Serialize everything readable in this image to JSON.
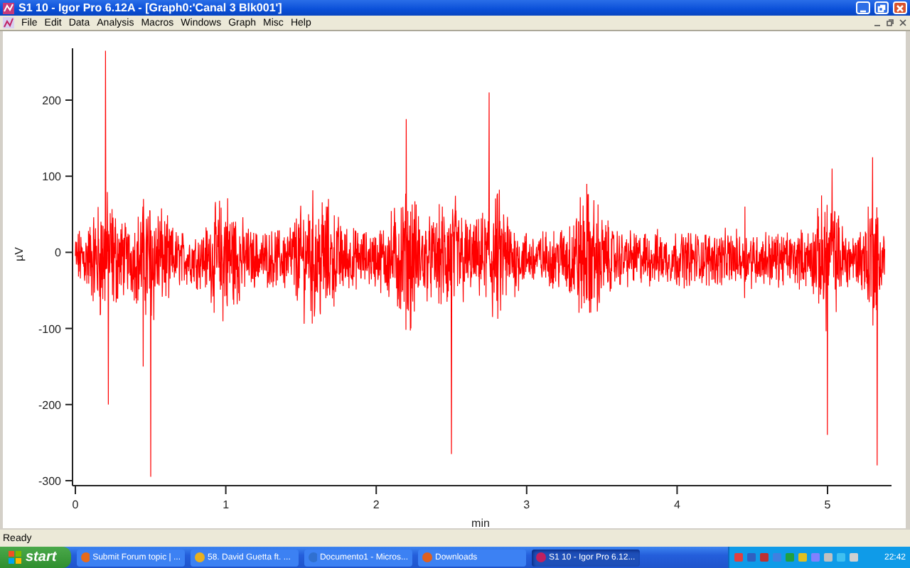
{
  "window": {
    "title": "S1 10 - Igor Pro 6.12A - [Graph0:'Canal 3 Blk001']"
  },
  "menu": [
    "File",
    "Edit",
    "Data",
    "Analysis",
    "Macros",
    "Windows",
    "Graph",
    "Misc",
    "Help"
  ],
  "graph": {
    "ylabel": "µV",
    "xlabel": "min",
    "yticks": [
      "200",
      "100",
      "0",
      "-100",
      "-200",
      "-300"
    ],
    "xticks": [
      "0",
      "1",
      "2",
      "3",
      "4",
      "5"
    ]
  },
  "status_bar": {
    "text": "Ready"
  },
  "taskbar": {
    "start": "start",
    "buttons": [
      {
        "label": "Submit Forum topic | ...",
        "selected": false
      },
      {
        "label": "58. David Guetta ft. ...",
        "selected": false
      },
      {
        "label": "Documento1 - Micros...",
        "selected": false
      },
      {
        "label": "Downloads",
        "selected": false
      },
      {
        "label": "S1 10 - Igor Pro 6.12...",
        "selected": true
      }
    ],
    "clock": "22:42"
  }
}
